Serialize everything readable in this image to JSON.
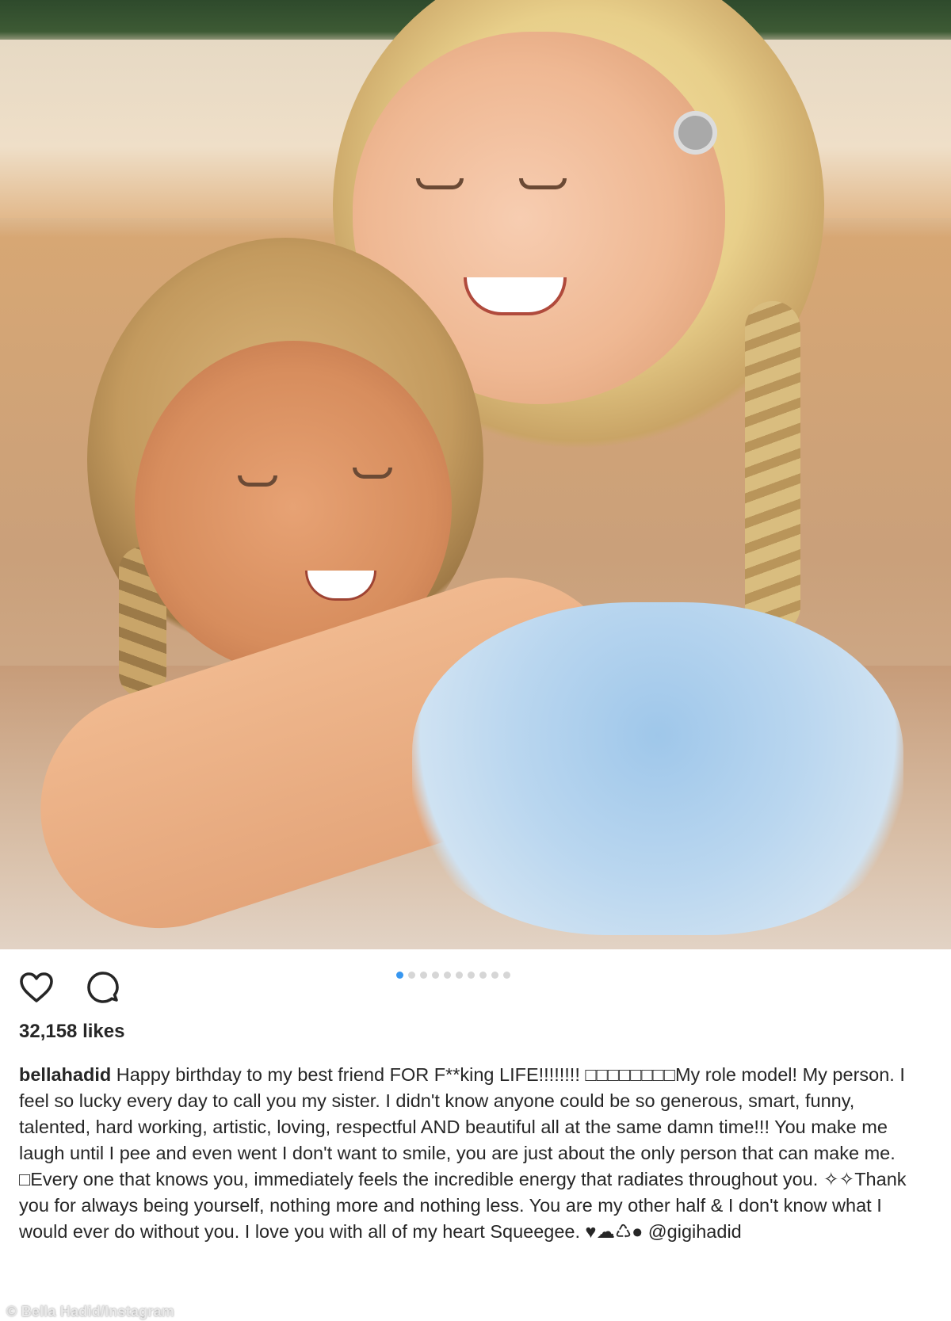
{
  "post": {
    "likes": "32,158 likes",
    "username": "bellahadid",
    "caption_text": " Happy birthday to my best friend FOR F**king LIFE!!!!!!!! □□□□□□□□My role model! My person. I feel so lucky every day to call you my sister. I didn't know anyone could be so generous, smart, funny, talented, hard working, artistic, loving, respectful AND beautiful all at the same damn time!!! You make me laugh until I pee and even went I don't want to smile, you are just about the only person that can make me. □Every one that knows you, immediately feels the incredible energy that radiates throughout you. ✧✧Thank you for always being yourself, nothing more and nothing less. You are my other half & I don't know what I would ever do without you. I love you with all of my heart Squeegee. ♥☁♺● ",
    "mention": "@gigihadid",
    "carousel": {
      "total": 10,
      "active_index": 0
    }
  },
  "icons": {
    "like": "heart-icon",
    "comment": "comment-icon"
  },
  "credit": "© Bella Hadid/Instagram",
  "colors": {
    "accent": "#3897f0",
    "text": "#262626",
    "dot_inactive": "#d6d6d6"
  }
}
